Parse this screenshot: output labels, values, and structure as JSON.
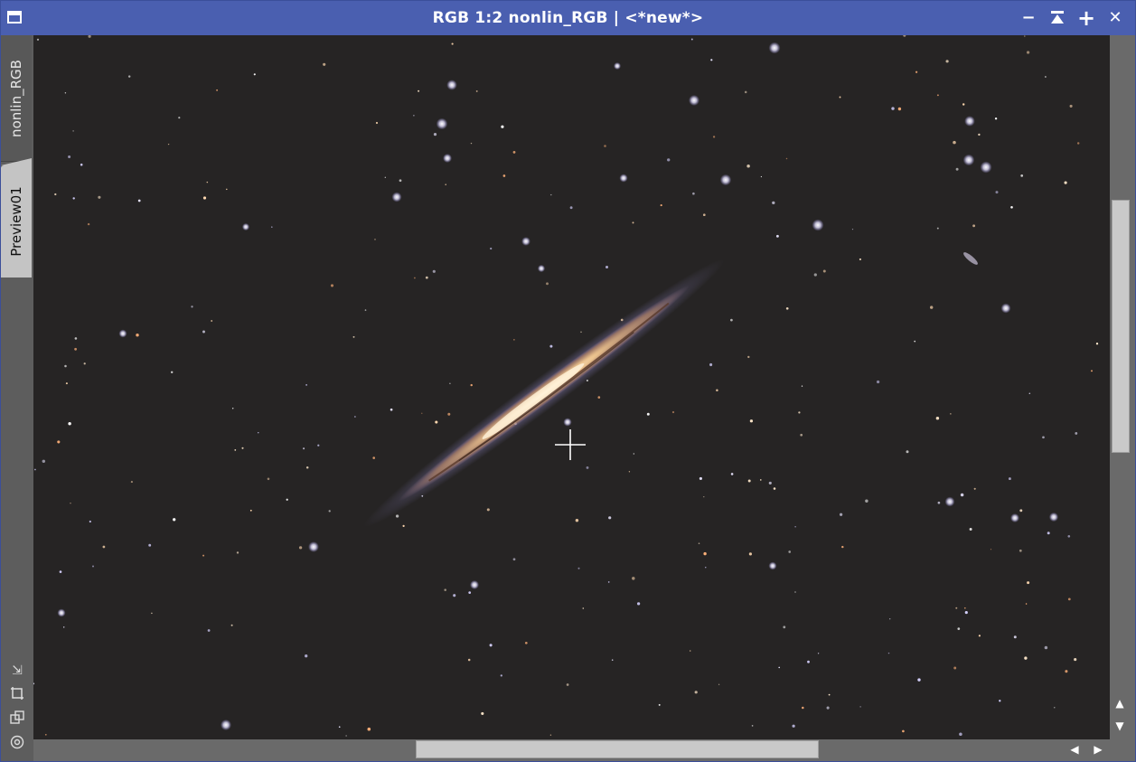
{
  "window": {
    "title": "RGB 1:2 nonlin_RGB | <*new*>",
    "title_bar_color": "#4a5fb0"
  },
  "title_buttons": [
    {
      "name": "minimize-icon",
      "glyph": "−"
    },
    {
      "name": "shade-icon",
      "glyph": "⏫"
    },
    {
      "name": "maximize-icon",
      "glyph": "+"
    },
    {
      "name": "close-icon",
      "glyph": "✕"
    }
  ],
  "tabs": {
    "main_view": "nonlin_RGB",
    "preview": "Preview01"
  },
  "side_tools": [
    {
      "name": "resize-corner-icon",
      "glyph": "⇲"
    },
    {
      "name": "crop-icon",
      "glyph": "⌑"
    },
    {
      "name": "clone-icon",
      "glyph": "⧉"
    },
    {
      "name": "target-icon",
      "glyph": "◎"
    }
  ],
  "scroll": {
    "up_glyph": "▲",
    "down_glyph": "▼",
    "left_glyph": "◀",
    "right_glyph": "▶"
  },
  "colors": {
    "image_background": "#262424",
    "galaxy_core": "#f2c890",
    "galaxy_halo": "#8f86c8",
    "scrollbar_thumb": "#c9c9c9"
  },
  "image": {
    "subject": "edge-on spiral galaxy star field",
    "cursor": "crosshair-icon"
  }
}
